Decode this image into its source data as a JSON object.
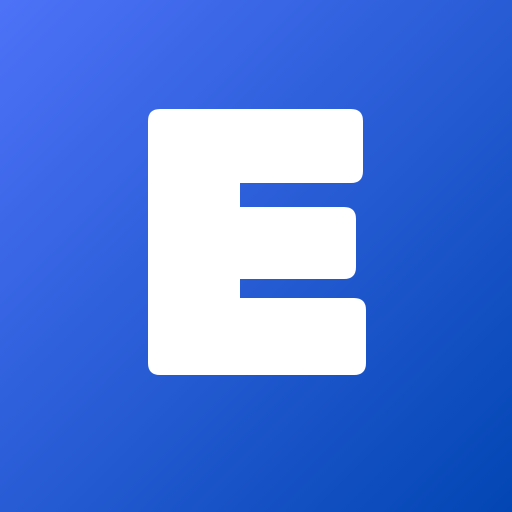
{
  "icon": {
    "name": "letter-e-logo-icon",
    "glyph": "E",
    "background_gradient": [
      "#4D72F7",
      "#0246B3"
    ],
    "glyph_color": "#FFFFFF"
  }
}
